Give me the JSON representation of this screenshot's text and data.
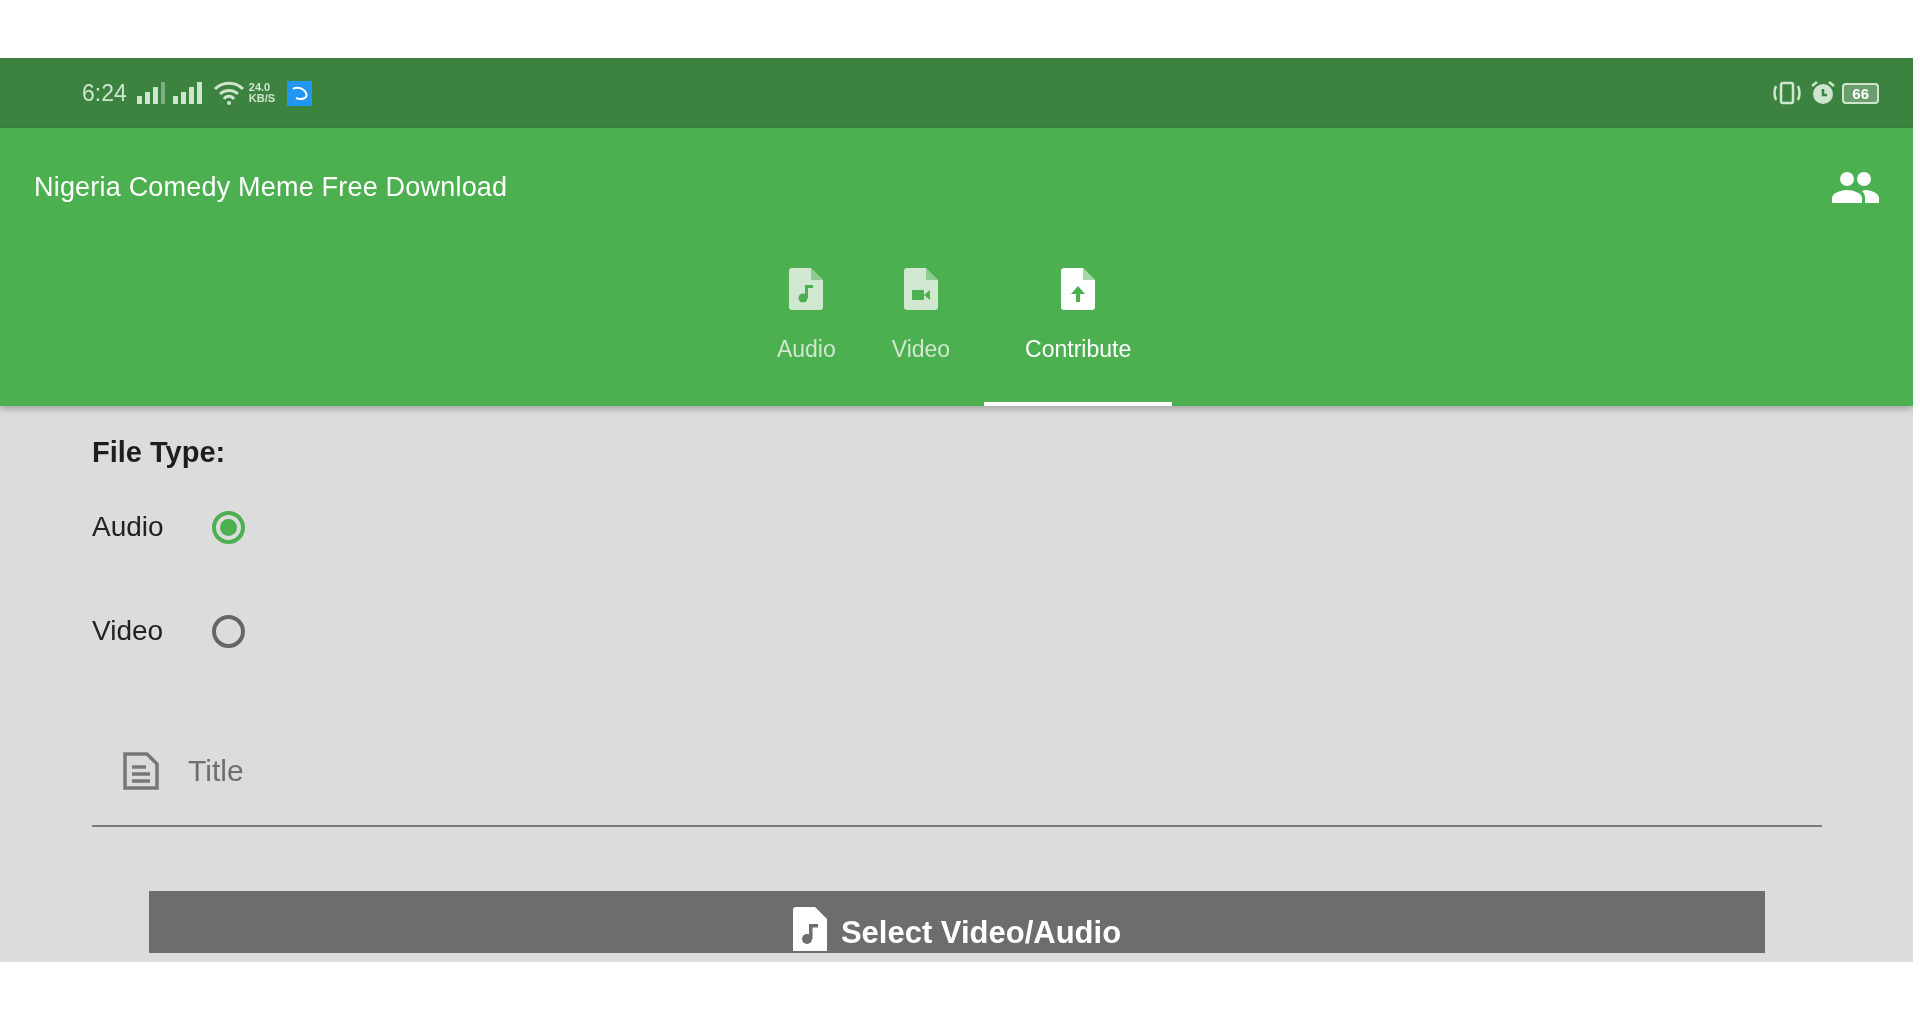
{
  "status_bar": {
    "time": "6:24",
    "speed": "24.0",
    "speed_unit": "KB/S",
    "battery": "66"
  },
  "app_bar": {
    "title": "Nigeria Comedy Meme Free Download"
  },
  "tabs": [
    {
      "label": "Audio",
      "kind": "audio",
      "selected": false
    },
    {
      "label": "Video",
      "kind": "video",
      "selected": false
    },
    {
      "label": "Contribute",
      "kind": "upload",
      "selected": true
    }
  ],
  "form": {
    "heading": "File Type:",
    "options": [
      {
        "label": "Audio",
        "selected": true
      },
      {
        "label": "Video",
        "selected": false
      }
    ],
    "title_field": {
      "placeholder": "Title"
    },
    "select_button": {
      "label": "Select Video/Audio"
    }
  }
}
